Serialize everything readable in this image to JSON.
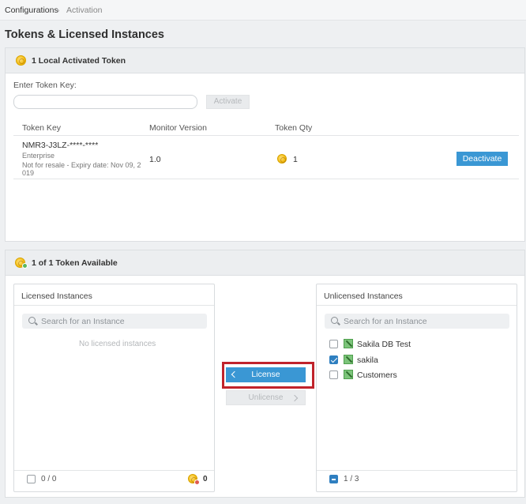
{
  "breadcrumb": {
    "root": "Configurations",
    "separator": "›",
    "current": "Activation"
  },
  "page_title": "Tokens & Licensed Instances",
  "tokens_panel": {
    "title": "1 Local Activated Token",
    "token_key_label": "Enter Token Key:",
    "token_key_value": "",
    "activate_label": "Activate",
    "columns": [
      "Token Key",
      "Monitor Version",
      "Token Qty"
    ],
    "row": {
      "key": "NMR3-J3LZ-****-****",
      "edition": "Enterprise",
      "note_line1": "Not for resale - Expiry date: Nov 09, 2",
      "note_line2": "019",
      "version": "1.0",
      "qty": "1",
      "deactivate_label": "Deactivate"
    }
  },
  "available_panel": {
    "title": "1 of 1 Token Available"
  },
  "licensed": {
    "title": "Licensed Instances",
    "search_placeholder": "Search for an Instance",
    "empty_text": "No licensed instances",
    "footer_count": "0 / 0",
    "tokens_left": "0"
  },
  "transfer": {
    "license_label": "License",
    "unlicense_label": "Unlicense"
  },
  "unlicensed": {
    "title": "Unlicensed Instances",
    "search_placeholder": "Search for an Instance",
    "items": [
      {
        "name": "Sakila DB Test",
        "checked": false
      },
      {
        "name": "sakila",
        "checked": true
      },
      {
        "name": "Customers",
        "checked": false
      }
    ],
    "footer_count": "1 / 3"
  },
  "colors": {
    "accent": "#3a97d4",
    "highlight": "#c0232b",
    "check": "#2f7fc0"
  }
}
